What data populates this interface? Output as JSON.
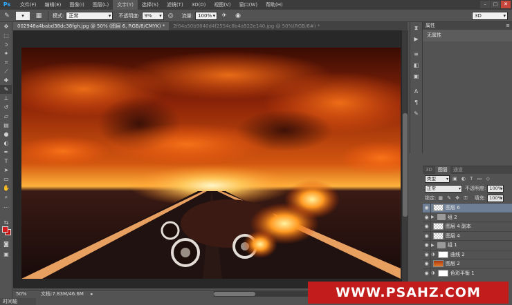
{
  "menubar": {
    "logo": "Ps",
    "items": [
      "文件(F)",
      "编辑(E)",
      "图像(I)",
      "图层(L)",
      "文字(Y)",
      "选择(S)",
      "滤镜(T)",
      "3D(D)",
      "视图(V)",
      "窗口(W)",
      "帮助(H)"
    ],
    "active_index": 4
  },
  "optbar": {
    "mode_label": "模式:",
    "mode_value": "正常",
    "opacity_label": "不透明度:",
    "opacity_value": "9%",
    "flow_label": "流量:",
    "flow_value": "100%",
    "workspace": "3D"
  },
  "tabs": [
    {
      "label": "002948a4babd38dc38fgh.jpg @ 50% (图层 6, RGB/8/CMYK) *",
      "active": true
    },
    {
      "label": "2f64a50b9840d4f2554c8b4a922e140.jpg @ 50%(RGB/8#) *",
      "active": false
    }
  ],
  "status": {
    "zoom": "50%",
    "doc": "文档:7.83M/46.6M",
    "timeline": "时间轴"
  },
  "props": {
    "title": "属性",
    "body": "无属性"
  },
  "layers_panel": {
    "tabs": [
      "3D",
      "图层",
      "通道"
    ],
    "active_tab": 1,
    "filter": "类型",
    "blend": "正常",
    "opacity_label": "不透明度:",
    "opacity_value": "100%",
    "lock_label": "锁定:",
    "fill_label": "填充:",
    "fill_value": "100%",
    "layers": [
      {
        "name": "图层 6",
        "kind": "pixel",
        "selected": true
      },
      {
        "name": "组 2",
        "kind": "group",
        "selected": false
      },
      {
        "name": "图层 4 副本",
        "kind": "pixel",
        "selected": false
      },
      {
        "name": "图层 4",
        "kind": "pixel",
        "selected": false
      },
      {
        "name": "组 1",
        "kind": "group",
        "selected": false
      },
      {
        "name": "曲线 2",
        "kind": "adjust",
        "selected": false
      },
      {
        "name": "图层 2",
        "kind": "image",
        "selected": false
      },
      {
        "name": "色彩平衡 1",
        "kind": "adjust",
        "selected": false
      }
    ]
  },
  "watermark": "WWW.PSAHZ.COM",
  "icons": {
    "tools": [
      "move-icon",
      "marquee-icon",
      "lasso-icon",
      "quick-select-icon",
      "crop-icon",
      "eyedropper-icon",
      "healing-icon",
      "brush-icon",
      "stamp-icon",
      "history-brush-icon",
      "eraser-icon",
      "gradient-icon",
      "blur-icon",
      "dodge-icon",
      "pen-icon",
      "type-icon",
      "path-select-icon",
      "shape-icon",
      "hand-icon",
      "zoom-icon"
    ]
  }
}
